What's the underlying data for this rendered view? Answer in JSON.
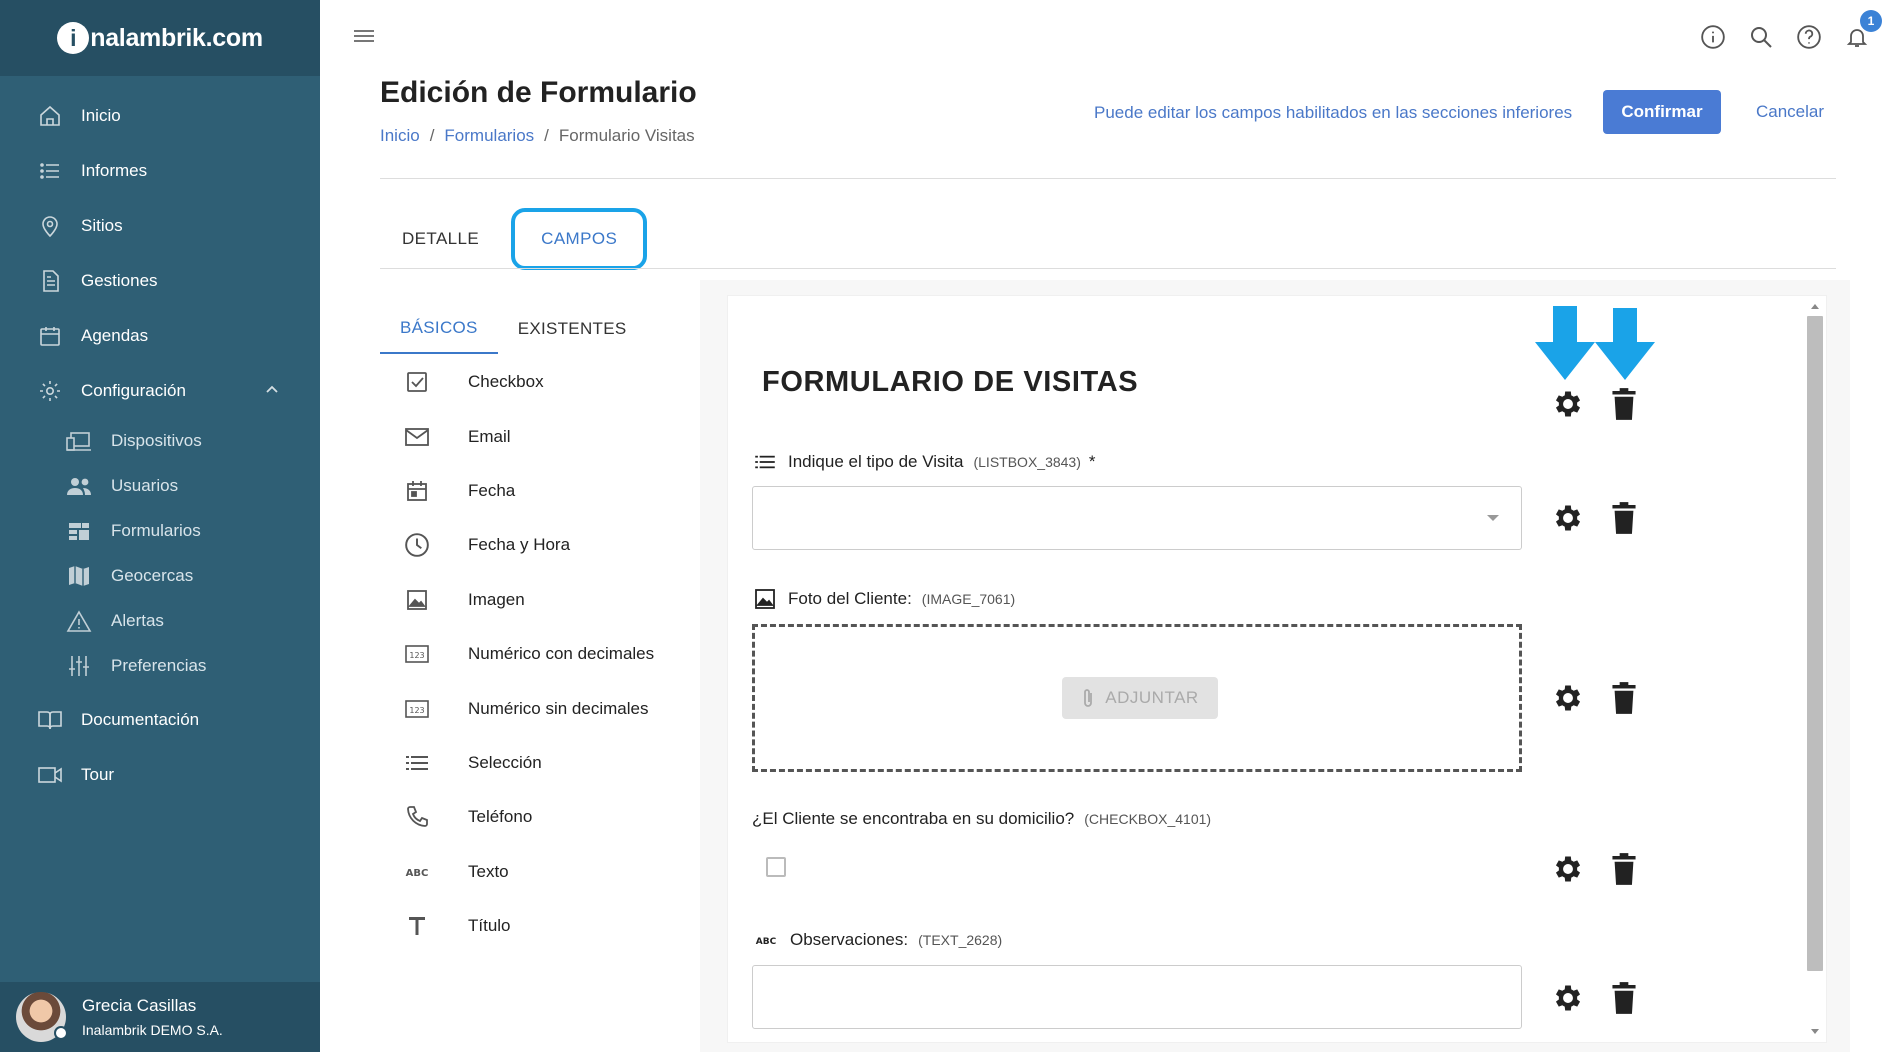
{
  "app": {
    "brand_prefix": "i",
    "brand_rest": "nalambrik.com"
  },
  "sidebar": {
    "items": [
      {
        "label": "Inicio",
        "icon": "home-icon"
      },
      {
        "label": "Informes",
        "icon": "list-icon"
      },
      {
        "label": "Sitios",
        "icon": "map-pin-icon"
      },
      {
        "label": "Gestiones",
        "icon": "document-icon"
      },
      {
        "label": "Agendas",
        "icon": "calendar-icon"
      },
      {
        "label": "Configuración",
        "icon": "gear-icon"
      }
    ],
    "sub_items": [
      {
        "label": "Dispositivos",
        "icon": "devices-icon"
      },
      {
        "label": "Usuarios",
        "icon": "users-icon"
      },
      {
        "label": "Formularios",
        "icon": "forms-icon"
      },
      {
        "label": "Geocercas",
        "icon": "map-icon"
      },
      {
        "label": "Alertas",
        "icon": "warning-icon"
      },
      {
        "label": "Preferencias",
        "icon": "sliders-icon"
      }
    ],
    "bottom_items": [
      {
        "label": "Documentación",
        "icon": "book-icon"
      },
      {
        "label": "Tour",
        "icon": "video-icon"
      }
    ],
    "user": {
      "name": "Grecia Casillas",
      "org": "Inalambrik DEMO S.A."
    }
  },
  "topbar": {
    "notifications_count": "1"
  },
  "header": {
    "title": "Edición de Formulario",
    "breadcrumb": [
      "Inicio",
      "Formularios",
      "Formulario Visitas"
    ],
    "separator": "/",
    "hint": "Puede editar los campos habilitados en las secciones inferiores",
    "confirm_label": "Confirmar",
    "cancel_label": "Cancelar"
  },
  "tabs": [
    {
      "label": "DETALLE"
    },
    {
      "label": "CAMPOS",
      "active": true
    }
  ],
  "subtabs": [
    {
      "label": "BÁSICOS",
      "active": true
    },
    {
      "label": "EXISTENTES"
    }
  ],
  "field_types": [
    {
      "label": "Checkbox",
      "icon": "checkbox-icon"
    },
    {
      "label": "Email",
      "icon": "email-icon"
    },
    {
      "label": "Fecha",
      "icon": "calendar-icon"
    },
    {
      "label": "Fecha y Hora",
      "icon": "clock-icon"
    },
    {
      "label": "Imagen",
      "icon": "image-icon"
    },
    {
      "label": "Numérico con decimales",
      "icon": "numeric-icon"
    },
    {
      "label": "Numérico sin decimales",
      "icon": "numeric-icon"
    },
    {
      "label": "Selección",
      "icon": "list-icon"
    },
    {
      "label": "Teléfono",
      "icon": "phone-icon"
    },
    {
      "label": "Texto",
      "icon": "abc-icon"
    },
    {
      "label": "Título",
      "icon": "title-icon"
    }
  ],
  "form": {
    "title": "FORMULARIO DE VISITAS",
    "fields": [
      {
        "label": "Indique el tipo de Visita",
        "code": "(LISTBOX_3843)",
        "required": "*",
        "type": "listbox",
        "value": ""
      },
      {
        "label": "Foto del Cliente:",
        "code": "(IMAGE_7061)",
        "type": "image",
        "attach_label": "ADJUNTAR"
      },
      {
        "label": "¿El Cliente se encontraba en su domicilio?",
        "code": "(CHECKBOX_4101)",
        "type": "checkbox",
        "checked": false
      },
      {
        "label": "Observaciones:",
        "code": "(TEXT_2628)",
        "type": "text",
        "value": ""
      }
    ]
  },
  "colors": {
    "sidebar_bg": "#2f5f75",
    "sidebar_dark": "#264f63",
    "accent": "#4a7bd4",
    "link": "#4a78c8",
    "highlight_ring": "#1aa3e8",
    "arrow": "#1aa3e8"
  }
}
